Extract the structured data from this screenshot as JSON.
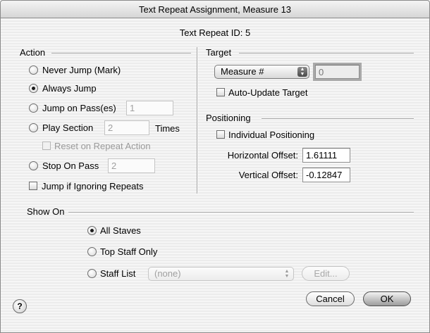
{
  "window": {
    "title": "Text Repeat Assignment, Measure 13"
  },
  "header": {
    "id_label": "Text Repeat ID: 5"
  },
  "action": {
    "title": "Action",
    "never_jump": "Never Jump (Mark)",
    "always_jump": "Always Jump",
    "jump_on_passes": "Jump on Pass(es)",
    "jump_on_passes_value": "1",
    "play_section": "Play Section",
    "play_section_value": "2",
    "times": "Times",
    "reset_on_repeat": "Reset on Repeat Action",
    "stop_on_pass": "Stop On Pass",
    "stop_on_pass_value": "2",
    "jump_if_ignoring": "Jump if Ignoring Repeats",
    "selected": "Always Jump"
  },
  "target": {
    "title": "Target",
    "type_selected": "Measure #",
    "value": "0",
    "auto_update": "Auto-Update Target"
  },
  "positioning": {
    "title": "Positioning",
    "individual": "Individual Positioning",
    "horizontal_label": "Horizontal Offset:",
    "horizontal_value": "1.61111",
    "vertical_label": "Vertical Offset:",
    "vertical_value": "-0.12847"
  },
  "show_on": {
    "title": "Show On",
    "all_staves": "All Staves",
    "top_staff_only": "Top Staff Only",
    "staff_list": "Staff List",
    "staff_list_selected": "(none)",
    "edit_label": "Edit...",
    "selected": "All Staves"
  },
  "buttons": {
    "cancel": "Cancel",
    "ok": "OK",
    "help": "?"
  }
}
